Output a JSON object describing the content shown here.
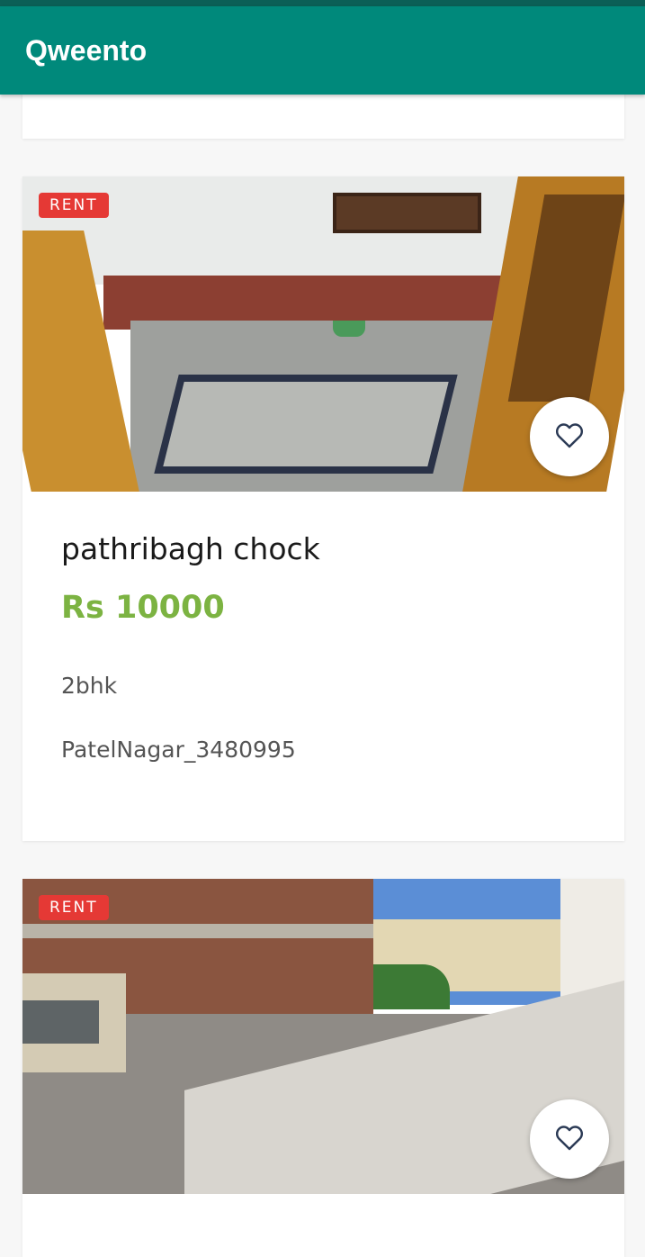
{
  "app": {
    "title": "Qweento"
  },
  "listings": [
    {
      "badge": "RENT",
      "title": "pathribagh chock",
      "price": "Rs 10000",
      "type": "2bhk",
      "code": "PatelNagar_3480995",
      "favorite_icon": "heart-outline-icon"
    },
    {
      "badge": "RENT",
      "favorite_icon": "heart-outline-icon"
    }
  ],
  "colors": {
    "app_bar": "#00897b",
    "status_strip": "#0b5f56",
    "badge": "#e53935",
    "price": "#7cb342"
  }
}
